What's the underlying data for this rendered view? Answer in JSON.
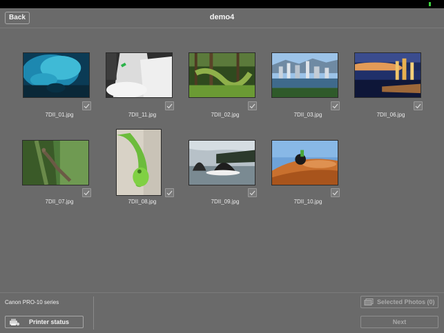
{
  "status_bar": {
    "battery_color": "#3bd23b"
  },
  "nav": {
    "back_label": "Back",
    "title": "demo4"
  },
  "photos": [
    {
      "filename": "7DII_01.jpg",
      "scene": "blue-ice-cave",
      "checked": true
    },
    {
      "filename": "7DII_11.jpg",
      "scene": "waterfall-kayak",
      "checked": true
    },
    {
      "filename": "7DII_02.jpg",
      "scene": "mossy-forest",
      "checked": true
    },
    {
      "filename": "7DII_03.jpg",
      "scene": "city-skyline-day",
      "checked": true
    },
    {
      "filename": "7DII_06.jpg",
      "scene": "city-skyline-dusk",
      "checked": true
    },
    {
      "filename": "7DII_07.jpg",
      "scene": "lizard-on-tree",
      "checked": true
    },
    {
      "filename": "7DII_08.jpg",
      "scene": "green-chameleon",
      "checked": true
    },
    {
      "filename": "7DII_09.jpg",
      "scene": "whales-breaching",
      "checked": true
    },
    {
      "filename": "7DII_10.jpg",
      "scene": "dirt-bike-dunes",
      "checked": true
    }
  ],
  "bottom": {
    "printer_name": "Canon PRO-10 series",
    "printer_status_label": "Printer status",
    "printer_icon": "printer-icon",
    "selected_photos_label": "Selected Photos (0)",
    "selected_icon": "photos-icon",
    "next_label": "Next"
  }
}
